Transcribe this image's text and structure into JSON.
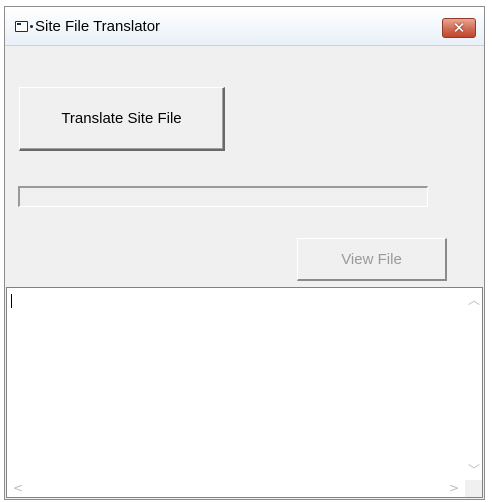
{
  "window": {
    "title": "Site File Translator",
    "close_glyph": "✕"
  },
  "main": {
    "translate_button_label": "Translate Site File",
    "progress_percent": 0,
    "view_button_label": "View File",
    "view_button_enabled": false,
    "output_text": ""
  },
  "icons": {
    "app": "app-window-icon",
    "close": "close-icon",
    "scroll_up": "chevron-up-icon",
    "scroll_down": "chevron-down-icon",
    "scroll_left": "chevron-left-icon",
    "scroll_right": "chevron-right-icon"
  },
  "colors": {
    "close_button": "#c0462d",
    "window_bg": "#f0f0f0",
    "disabled_text": "#9a9a9a"
  }
}
